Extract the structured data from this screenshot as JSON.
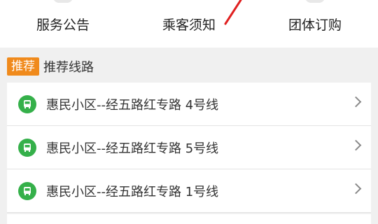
{
  "nav": {
    "items": [
      {
        "label": "服务公告"
      },
      {
        "label": "乘客须知"
      },
      {
        "label": "团体订购"
      }
    ]
  },
  "section": {
    "badge": "推荐",
    "title": "推荐线路"
  },
  "routes": [
    {
      "label": "惠民小区--经五路红专路 4号线"
    },
    {
      "label": "惠民小区--经五路红专路 5号线"
    },
    {
      "label": "惠民小区--经五路红专路 1号线"
    }
  ],
  "colors": {
    "accent_orange": "#f08a1c",
    "bus_green": "#35b04a",
    "annotation_red": "#e02020"
  }
}
